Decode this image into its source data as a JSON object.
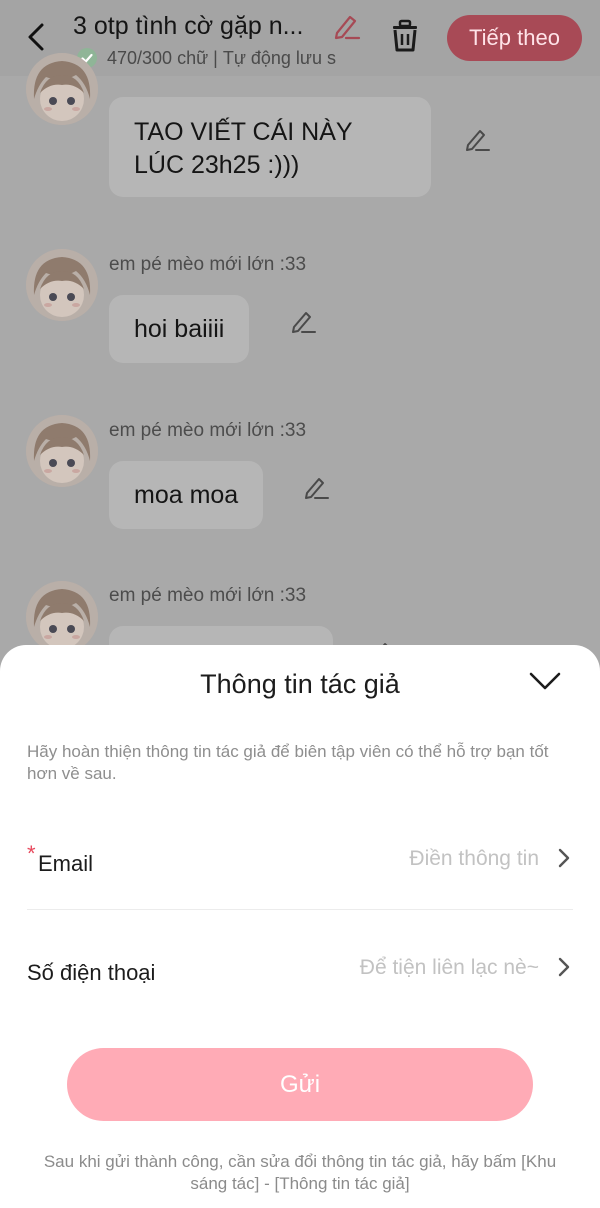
{
  "header": {
    "title": "3 otp tình cờ gặp n...",
    "word_count": "470/300 chữ",
    "autosave": "Tự động lưu s",
    "next_label": "Tiếp theo"
  },
  "messages": [
    {
      "author": "",
      "text_line1": "TAO VIẾT CÁI NÀY",
      "text_line2": "LÚC 23h25 :)))"
    },
    {
      "author": "em pé mèo mới lớn :33",
      "text": "hoi baiiii"
    },
    {
      "author": "em pé mèo mới lớn :33",
      "text": "moa moa"
    },
    {
      "author": "em pé mèo mới lớn :33",
      "text": ""
    }
  ],
  "sheet": {
    "title": "Thông tin tác giả",
    "description": "Hãy hoàn thiện thông tin tác giả để biên tập viên có thể hỗ trợ bạn tốt hơn về sau.",
    "email": {
      "required_mark": "*",
      "label": "Email",
      "placeholder": "Điền thông tin"
    },
    "phone": {
      "label": "Số điện thoại",
      "placeholder": "Để tiện liên lạc nè~"
    },
    "submit_label": "Gửi",
    "note": "Sau khi gửi thành công, cần sửa đổi thông tin tác giả, hãy bấm [Khu sáng tác] - [Thông tin tác giả]"
  },
  "colors": {
    "accent": "#e0485c",
    "submit_disabled": "#ffabb6",
    "overlay": "#a9a9a9"
  },
  "icons": [
    "back-arrow-icon",
    "check-circle-icon",
    "pencil-icon",
    "trash-icon",
    "chevron-down-icon",
    "chevron-right-icon"
  ]
}
